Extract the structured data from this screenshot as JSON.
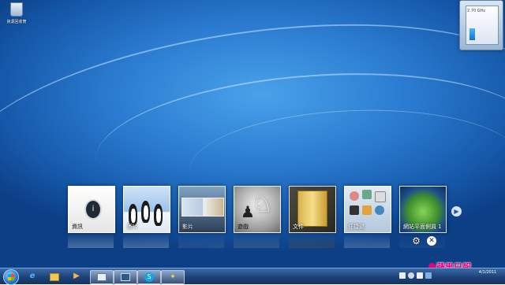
{
  "desktop": {
    "recycle_bin_label": "資源回收筒"
  },
  "gadget": {
    "cpu_frequency": "2.70 GHz",
    "cpu_level_percent": 55
  },
  "center": {
    "tiles": [
      {
        "label": "資訊",
        "icon": "info-icon"
      },
      {
        "label": "圖片",
        "icon": "penguins-icon"
      },
      {
        "label": "影片",
        "icon": "video-icon"
      },
      {
        "label": "遊戲",
        "icon": "chess-icon"
      },
      {
        "label": "文件",
        "icon": "folder-icon"
      },
      {
        "label": "便捷鍵",
        "icon": "accessories-icon"
      },
      {
        "label": "網站平面側員 1",
        "icon": "globe-icon"
      }
    ],
    "next_icon": "chevron-right-icon",
    "settings_icon": "gear-icon",
    "close_icon": "close-icon"
  },
  "taskbar": {
    "start_icon": "windows-orb-icon",
    "pinned": [
      {
        "name": "ie",
        "icon": "internet-explorer-icon"
      },
      {
        "name": "explorer",
        "icon": "folder-icon"
      },
      {
        "name": "media-player",
        "icon": "media-player-icon"
      },
      {
        "name": "app-active-1",
        "icon": "window-icon"
      },
      {
        "name": "app-active-2",
        "icon": "monitor-icon"
      },
      {
        "name": "skype",
        "icon": "skype-icon"
      },
      {
        "name": "live",
        "icon": "live-icon"
      }
    ],
    "clock_date": "4/1/2011"
  },
  "watermark": "蘋果日報"
}
